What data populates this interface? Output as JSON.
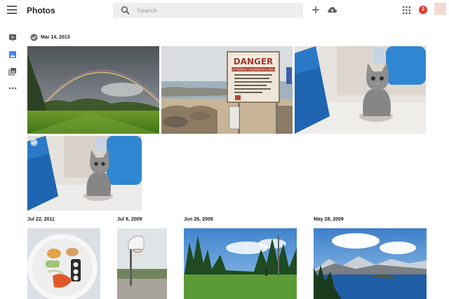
{
  "app": {
    "title": "Photos"
  },
  "search": {
    "placeholder": "Search"
  },
  "header": {
    "notification_count": "2"
  },
  "groups": [
    {
      "date": "Mar 14, 2013"
    },
    {
      "date": "Jul 22, 2011"
    },
    {
      "date": "Jul 8, 2009"
    },
    {
      "date": "Jun 26, 2009"
    },
    {
      "date": "May 28, 2009"
    }
  ],
  "sign": {
    "heading": "DANGER",
    "subheading": "EXTREMELY HAZARDOUS AREA"
  },
  "colors": {
    "accent": "#4285f4",
    "badge": "#e53935",
    "search_bg": "#eeeeee"
  },
  "icons": {
    "menu": "menu-icon",
    "search": "search-icon",
    "add": "plus-icon",
    "upload": "cloud-upload-icon",
    "apps": "apps-grid-icon",
    "assistant": "assistant-icon",
    "photos": "photos-icon",
    "albums": "albums-icon",
    "more": "more-icon",
    "select": "check-circle-icon"
  }
}
